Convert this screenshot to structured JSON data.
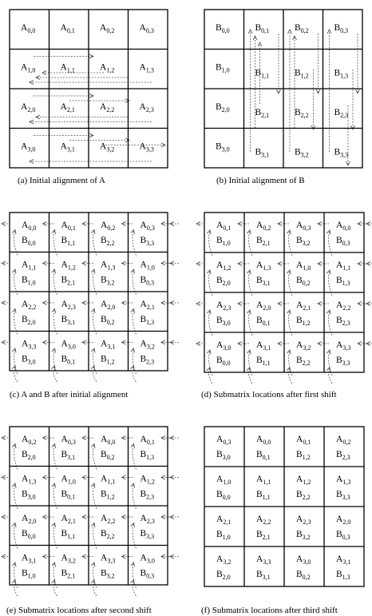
{
  "panels": [
    {
      "id": "a",
      "caption": "(a)  Initial alignment of A",
      "cells": [
        [
          [
            "A",
            "0,0"
          ],
          [
            "A",
            "0,1"
          ],
          [
            "A",
            "0,2"
          ],
          [
            "A",
            "0,3"
          ]
        ],
        [
          [
            "A",
            "1,0"
          ],
          [
            "A",
            "1,1"
          ],
          [
            "A",
            "1,2"
          ],
          [
            "A",
            "1,3"
          ]
        ],
        [
          [
            "A",
            "2,0"
          ],
          [
            "A",
            "2,1"
          ],
          [
            "A",
            "2,2"
          ],
          [
            "A",
            "2,3"
          ]
        ],
        [
          [
            "A",
            "3,0"
          ],
          [
            "A",
            "3,1"
          ],
          [
            "A",
            "3,2"
          ],
          [
            "A",
            "3,3"
          ]
        ]
      ]
    },
    {
      "id": "b",
      "caption": "(b)  Initial alignment of B",
      "cells": [
        [
          [
            "B",
            "0,0"
          ],
          [
            "B",
            "0,1"
          ],
          [
            "B",
            "0,2"
          ],
          [
            "B",
            "0,3"
          ]
        ],
        [
          [
            "B",
            "1,0"
          ],
          [
            "B",
            "1,1"
          ],
          [
            "B",
            "1,2"
          ],
          [
            "B",
            "1,3"
          ]
        ],
        [
          [
            "B",
            "2,0"
          ],
          [
            "B",
            "2,1"
          ],
          [
            "B",
            "2,2"
          ],
          [
            "B",
            "2,3"
          ]
        ],
        [
          [
            "B",
            "3,0"
          ],
          [
            "B",
            "3,1"
          ],
          [
            "B",
            "3,2"
          ],
          [
            "B",
            "3,3"
          ]
        ]
      ]
    },
    {
      "id": "c",
      "caption": "(c)  A and B after initial alignment",
      "cells": [
        [
          [
            "A",
            "0,0",
            "B",
            "0,0"
          ],
          [
            "A",
            "0,1",
            "B",
            "1,1"
          ],
          [
            "A",
            "0,2",
            "B",
            "2,2"
          ],
          [
            "A",
            "0,3",
            "B",
            "3,3"
          ]
        ],
        [
          [
            "A",
            "1,1",
            "B",
            "1,0"
          ],
          [
            "A",
            "1,2",
            "B",
            "2,1"
          ],
          [
            "A",
            "1,3",
            "B",
            "3,2"
          ],
          [
            "A",
            "1,0",
            "B",
            "0,3"
          ]
        ],
        [
          [
            "A",
            "2,2",
            "B",
            "2,0"
          ],
          [
            "A",
            "2,3",
            "B",
            "3,1"
          ],
          [
            "A",
            "2,0",
            "B",
            "0,2"
          ],
          [
            "A",
            "2,1",
            "B",
            "1,3"
          ]
        ],
        [
          [
            "A",
            "3,3",
            "B",
            "3,0"
          ],
          [
            "A",
            "3,0",
            "B",
            "0,1"
          ],
          [
            "A",
            "3,1",
            "B",
            "1,2"
          ],
          [
            "A",
            "3,2",
            "B",
            "2,3"
          ]
        ]
      ]
    },
    {
      "id": "d",
      "caption": "(d)  Submatrix locations after first shift",
      "cells": [
        [
          [
            "A",
            "0,1",
            "B",
            "1,0"
          ],
          [
            "A",
            "0,2",
            "B",
            "2,1"
          ],
          [
            "A",
            "0,3",
            "B",
            "3,2"
          ],
          [
            "A",
            "0,0",
            "B",
            "0,3"
          ]
        ],
        [
          [
            "A",
            "1,2",
            "B",
            "2,0"
          ],
          [
            "A",
            "1,3",
            "B",
            "3,1"
          ],
          [
            "A",
            "1,0",
            "B",
            "0,2"
          ],
          [
            "A",
            "1,1",
            "B",
            "1,3"
          ]
        ],
        [
          [
            "A",
            "2,3",
            "B",
            "3,0"
          ],
          [
            "A",
            "2,0",
            "B",
            "0,1"
          ],
          [
            "A",
            "2,1",
            "B",
            "1,2"
          ],
          [
            "A",
            "2,2",
            "B",
            "2,3"
          ]
        ],
        [
          [
            "A",
            "3,0",
            "B",
            "0,0"
          ],
          [
            "A",
            "3,1",
            "B",
            "1,1"
          ],
          [
            "A",
            "3,2",
            "B",
            "2,2"
          ],
          [
            "A",
            "3,3",
            "B",
            "3,3"
          ]
        ]
      ]
    },
    {
      "id": "e",
      "caption": "(e)  Submatrix locations after second shift",
      "cells": [
        [
          [
            "A",
            "0,2",
            "B",
            "2,0"
          ],
          [
            "A",
            "0,3",
            "B",
            "3,1"
          ],
          [
            "A",
            "0,0",
            "B",
            "0,2"
          ],
          [
            "A",
            "0,1",
            "B",
            "1,3"
          ]
        ],
        [
          [
            "A",
            "1,3",
            "B",
            "3,0"
          ],
          [
            "A",
            "1,0",
            "B",
            "0,1"
          ],
          [
            "A",
            "1,1",
            "B",
            "1,2"
          ],
          [
            "A",
            "1,2",
            "B",
            "2,3"
          ]
        ],
        [
          [
            "A",
            "2,0",
            "B",
            "0,0"
          ],
          [
            "A",
            "2,1",
            "B",
            "1,1"
          ],
          [
            "A",
            "2,2",
            "B",
            "2,2"
          ],
          [
            "A",
            "2,3",
            "B",
            "3,3"
          ]
        ],
        [
          [
            "A",
            "3,1",
            "B",
            "1,0"
          ],
          [
            "A",
            "3,2",
            "B",
            "2,1"
          ],
          [
            "A",
            "3,3",
            "B",
            "3,2"
          ],
          [
            "A",
            "3,0",
            "B",
            "0,3"
          ]
        ]
      ]
    },
    {
      "id": "f",
      "caption": "(f)  Submatrix locations after third shift",
      "cells": [
        [
          [
            "A",
            "0,3",
            "B",
            "3,0"
          ],
          [
            "A",
            "0,0",
            "B",
            "0,1"
          ],
          [
            "A",
            "0,1",
            "B",
            "1,2"
          ],
          [
            "A",
            "0,2",
            "B",
            "2,3"
          ]
        ],
        [
          [
            "A",
            "1,0",
            "B",
            "0,0"
          ],
          [
            "A",
            "1,1",
            "B",
            "1,1"
          ],
          [
            "A",
            "1,2",
            "B",
            "2,2"
          ],
          [
            "A",
            "1,3",
            "B",
            "3,3"
          ]
        ],
        [
          [
            "A",
            "2,1",
            "B",
            "1,0"
          ],
          [
            "A",
            "2,2",
            "B",
            "2,1"
          ],
          [
            "A",
            "2,3",
            "B",
            "3,2"
          ],
          [
            "A",
            "2,0",
            "B",
            "0,3"
          ]
        ],
        [
          [
            "A",
            "3,2",
            "B",
            "2,0"
          ],
          [
            "A",
            "3,3",
            "B",
            "3,1"
          ],
          [
            "A",
            "3,0",
            "B",
            "0,2"
          ],
          [
            "A",
            "3,1",
            "B",
            "1,3"
          ]
        ]
      ]
    }
  ]
}
